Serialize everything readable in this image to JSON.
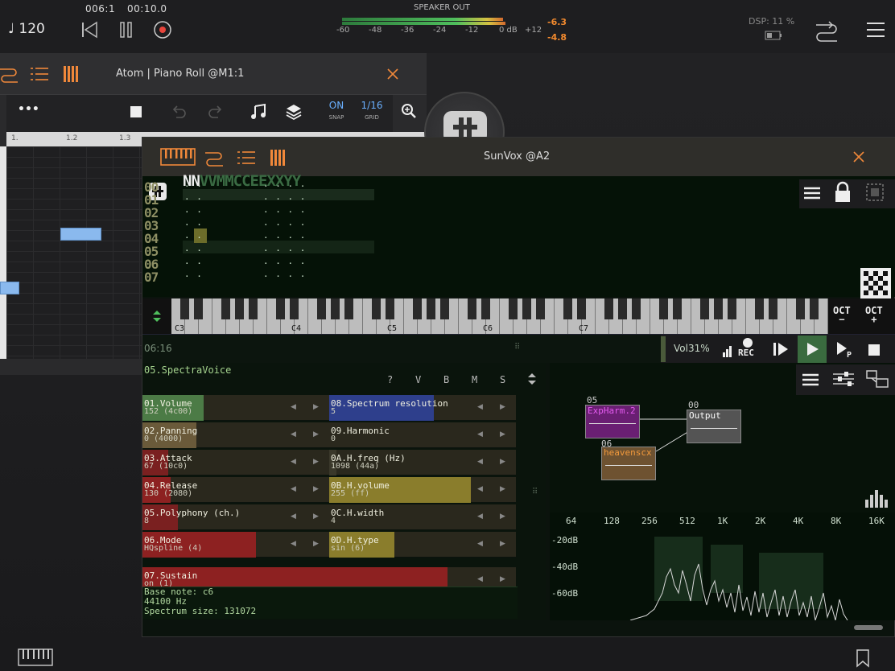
{
  "topbar": {
    "tempo": "♩ 120",
    "position": "006:1",
    "time": "00:10.0",
    "meter": {
      "title": "SPEAKER OUT",
      "ticks": [
        "-60",
        "-48",
        "-36",
        "-24",
        "-12",
        "0 dB",
        "+12"
      ],
      "left_val": "-6.3",
      "right_val": "-4.8",
      "level_left": 0.8,
      "level_right": 0.81
    },
    "dsp": "DSP: 11 %"
  },
  "piano_roll": {
    "title": "Atom | Piano Roll @M1:1",
    "more": "•••",
    "snap_value": "ON",
    "snap_label": "SNAP",
    "grid_value": "1/16",
    "grid_label": "GRID",
    "ruler": [
      "1.",
      "1.2",
      "1.3"
    ]
  },
  "sunvox": {
    "title": "SunVox @A2",
    "pattern": {
      "header_a": "NN",
      "header_b": "VVMMCCEEXXYY",
      "rows": [
        "00",
        "01",
        "02",
        "03",
        "04",
        "05",
        "06",
        "07"
      ]
    },
    "keyboard": {
      "octave_labels": [
        "C3",
        "C4",
        "C5",
        "C6",
        "C7"
      ],
      "oct_minus": "OCT",
      "oct_plus": "OCT"
    },
    "transport": {
      "time": "06:16",
      "volume": "Vol31%",
      "rec": "REC"
    },
    "module": {
      "name": "05.SpectraVoice",
      "tabs": [
        "?",
        "V",
        "B",
        "M",
        "S"
      ],
      "controllers": [
        {
          "label": "01.Volume",
          "value": "152 (4c00)",
          "fill": 0.43
        },
        {
          "label": "08.Spectrum resolution",
          "value": "5",
          "fill": 0.74
        },
        {
          "label": "02.Panning",
          "value": "0 (4000)",
          "fill": 0.38
        },
        {
          "label": "09.Harmonic",
          "value": "0",
          "fill": 0.0
        },
        {
          "label": "03.Attack",
          "value": "67 (10c0)",
          "fill": 0.18
        },
        {
          "label": "0A.H.freq (Hz)",
          "value": "1098 (44a)",
          "fill": 0.05
        },
        {
          "label": "04.Release",
          "value": "130 (2080)",
          "fill": 0.2
        },
        {
          "label": "0B.H.volume",
          "value": "255 (ff)",
          "fill": 1.0
        },
        {
          "label": "05.Polyphony (ch.)",
          "value": "8",
          "fill": 0.25
        },
        {
          "label": "0C.H.width",
          "value": "4",
          "fill": 0.0
        },
        {
          "label": "06.Mode",
          "value": "HQspline (4)",
          "fill": 0.8
        },
        {
          "label": "0D.H.type",
          "value": "sin (6)",
          "fill": 0.46
        },
        {
          "label": "07.Sustain",
          "value": "on (1)",
          "fill": 0.93
        }
      ],
      "info": [
        "Base note: c6",
        "44100 Hz",
        "Spectrum size: 131072"
      ]
    },
    "modules": [
      {
        "id": "05",
        "label": "ExpHarm.2",
        "color": "#6a1f73",
        "text_color": "#e35bef"
      },
      {
        "id": "00",
        "label": "Output",
        "color": "#545454",
        "text_color": "#ffffff"
      },
      {
        "id": "06",
        "label": "heavenscx",
        "color": "#6e5231",
        "text_color": "#f39a3c"
      }
    ],
    "spectrum": {
      "freqs": [
        "64",
        "128",
        "256",
        "512",
        "1K",
        "2K",
        "4K",
        "8K",
        "16K"
      ],
      "dbs": [
        "-20dB",
        "-40dB",
        "-60dB"
      ]
    }
  },
  "colors": {
    "accent": "#f0883a",
    "volume": "#4c7b46",
    "red": "#8d2121",
    "yellow": "#8a7d2c",
    "blue": "#2e3f8c"
  }
}
